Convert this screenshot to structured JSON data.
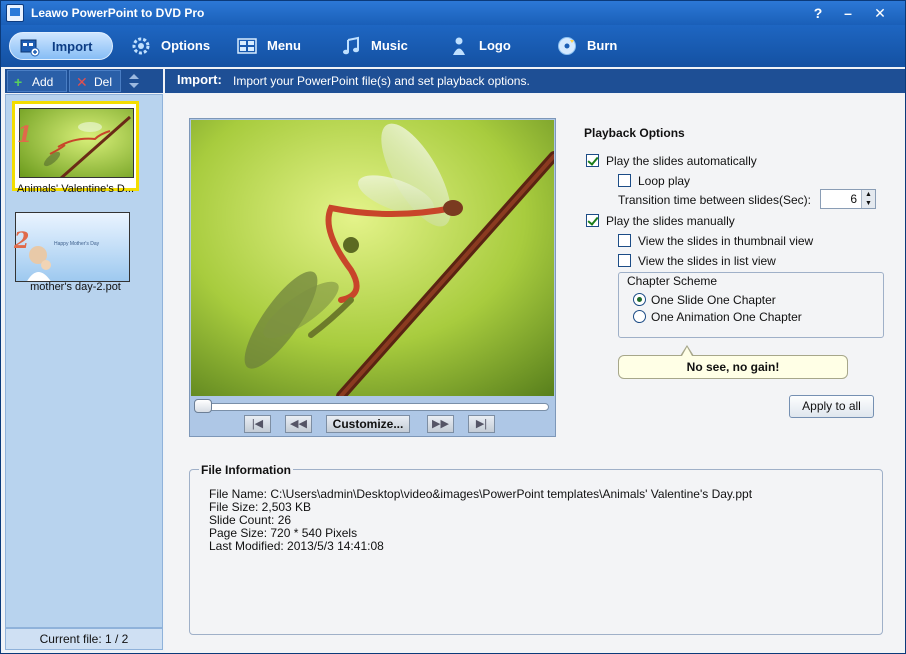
{
  "window": {
    "title": "Leawo PowerPoint to DVD Pro",
    "help": "?",
    "minimize": "–",
    "close": "✕"
  },
  "toolbar": {
    "items": [
      {
        "id": "import",
        "label": "Import",
        "icon": "import-icon"
      },
      {
        "id": "options",
        "label": "Options",
        "icon": "gear-icon"
      },
      {
        "id": "menu",
        "label": "Menu",
        "icon": "menu-grid-icon"
      },
      {
        "id": "music",
        "label": "Music",
        "icon": "music-note-icon"
      },
      {
        "id": "logo",
        "label": "Logo",
        "icon": "person-icon"
      },
      {
        "id": "burn",
        "label": "Burn",
        "icon": "disc-icon"
      }
    ]
  },
  "leftbar": {
    "add": "Add",
    "add_icon": "plus-icon",
    "del": "Del",
    "del_icon": "x-icon"
  },
  "slides": [
    {
      "num": "1",
      "caption": "Animals' Valentine's D...",
      "selected": true
    },
    {
      "num": "2",
      "caption": "mother's day-2.pot",
      "selected": false,
      "mini_text": "Happy Mother's Day"
    }
  ],
  "status": {
    "text": "Current file: 1 / 2"
  },
  "header": {
    "title": "Import:",
    "desc": "Import your PowerPoint file(s) and set playback options."
  },
  "preview": {
    "customize": "Customize...",
    "progress": 0.0,
    "btn_first": "|◀",
    "btn_prev": "◀◀",
    "btn_next": "▶▶",
    "btn_last": "▶|"
  },
  "playback": {
    "title": "Playback Options",
    "auto": "Play the slides automatically",
    "loop": "Loop play",
    "transition": "Transition time between slides(Sec):",
    "transition_value": "6",
    "manual": "Play the slides manually",
    "thumbnail": "View the slides in thumbnail view",
    "listview": "View the slides in list view",
    "chapter_title": "Chapter Scheme",
    "chapter_one_slide": "One Slide One Chapter",
    "chapter_one_anim": "One Animation One Chapter",
    "tip": "No see, no gain!",
    "apply": "Apply to all"
  },
  "fileinfo": {
    "title": "File Information",
    "name": "File Name: C:\\Users\\admin\\Desktop\\video&images\\PowerPoint templates\\Animals' Valentine's Day.ppt",
    "size": "File Size: 2,503 KB",
    "count": "Slide Count: 26",
    "page": "Page Size: 720 * 540 Pixels",
    "modified": "Last Modified: 2013/5/3 14:41:08"
  }
}
